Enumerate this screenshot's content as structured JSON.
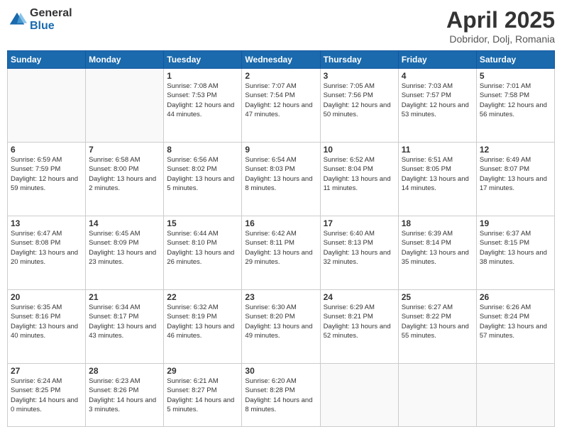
{
  "header": {
    "logo_general": "General",
    "logo_blue": "Blue",
    "month_title": "April 2025",
    "location": "Dobridor, Dolj, Romania"
  },
  "days_of_week": [
    "Sunday",
    "Monday",
    "Tuesday",
    "Wednesday",
    "Thursday",
    "Friday",
    "Saturday"
  ],
  "weeks": [
    [
      {
        "day": "",
        "info": ""
      },
      {
        "day": "",
        "info": ""
      },
      {
        "day": "1",
        "info": "Sunrise: 7:08 AM\nSunset: 7:53 PM\nDaylight: 12 hours and 44 minutes."
      },
      {
        "day": "2",
        "info": "Sunrise: 7:07 AM\nSunset: 7:54 PM\nDaylight: 12 hours and 47 minutes."
      },
      {
        "day": "3",
        "info": "Sunrise: 7:05 AM\nSunset: 7:56 PM\nDaylight: 12 hours and 50 minutes."
      },
      {
        "day": "4",
        "info": "Sunrise: 7:03 AM\nSunset: 7:57 PM\nDaylight: 12 hours and 53 minutes."
      },
      {
        "day": "5",
        "info": "Sunrise: 7:01 AM\nSunset: 7:58 PM\nDaylight: 12 hours and 56 minutes."
      }
    ],
    [
      {
        "day": "6",
        "info": "Sunrise: 6:59 AM\nSunset: 7:59 PM\nDaylight: 12 hours and 59 minutes."
      },
      {
        "day": "7",
        "info": "Sunrise: 6:58 AM\nSunset: 8:00 PM\nDaylight: 13 hours and 2 minutes."
      },
      {
        "day": "8",
        "info": "Sunrise: 6:56 AM\nSunset: 8:02 PM\nDaylight: 13 hours and 5 minutes."
      },
      {
        "day": "9",
        "info": "Sunrise: 6:54 AM\nSunset: 8:03 PM\nDaylight: 13 hours and 8 minutes."
      },
      {
        "day": "10",
        "info": "Sunrise: 6:52 AM\nSunset: 8:04 PM\nDaylight: 13 hours and 11 minutes."
      },
      {
        "day": "11",
        "info": "Sunrise: 6:51 AM\nSunset: 8:05 PM\nDaylight: 13 hours and 14 minutes."
      },
      {
        "day": "12",
        "info": "Sunrise: 6:49 AM\nSunset: 8:07 PM\nDaylight: 13 hours and 17 minutes."
      }
    ],
    [
      {
        "day": "13",
        "info": "Sunrise: 6:47 AM\nSunset: 8:08 PM\nDaylight: 13 hours and 20 minutes."
      },
      {
        "day": "14",
        "info": "Sunrise: 6:45 AM\nSunset: 8:09 PM\nDaylight: 13 hours and 23 minutes."
      },
      {
        "day": "15",
        "info": "Sunrise: 6:44 AM\nSunset: 8:10 PM\nDaylight: 13 hours and 26 minutes."
      },
      {
        "day": "16",
        "info": "Sunrise: 6:42 AM\nSunset: 8:11 PM\nDaylight: 13 hours and 29 minutes."
      },
      {
        "day": "17",
        "info": "Sunrise: 6:40 AM\nSunset: 8:13 PM\nDaylight: 13 hours and 32 minutes."
      },
      {
        "day": "18",
        "info": "Sunrise: 6:39 AM\nSunset: 8:14 PM\nDaylight: 13 hours and 35 minutes."
      },
      {
        "day": "19",
        "info": "Sunrise: 6:37 AM\nSunset: 8:15 PM\nDaylight: 13 hours and 38 minutes."
      }
    ],
    [
      {
        "day": "20",
        "info": "Sunrise: 6:35 AM\nSunset: 8:16 PM\nDaylight: 13 hours and 40 minutes."
      },
      {
        "day": "21",
        "info": "Sunrise: 6:34 AM\nSunset: 8:17 PM\nDaylight: 13 hours and 43 minutes."
      },
      {
        "day": "22",
        "info": "Sunrise: 6:32 AM\nSunset: 8:19 PM\nDaylight: 13 hours and 46 minutes."
      },
      {
        "day": "23",
        "info": "Sunrise: 6:30 AM\nSunset: 8:20 PM\nDaylight: 13 hours and 49 minutes."
      },
      {
        "day": "24",
        "info": "Sunrise: 6:29 AM\nSunset: 8:21 PM\nDaylight: 13 hours and 52 minutes."
      },
      {
        "day": "25",
        "info": "Sunrise: 6:27 AM\nSunset: 8:22 PM\nDaylight: 13 hours and 55 minutes."
      },
      {
        "day": "26",
        "info": "Sunrise: 6:26 AM\nSunset: 8:24 PM\nDaylight: 13 hours and 57 minutes."
      }
    ],
    [
      {
        "day": "27",
        "info": "Sunrise: 6:24 AM\nSunset: 8:25 PM\nDaylight: 14 hours and 0 minutes."
      },
      {
        "day": "28",
        "info": "Sunrise: 6:23 AM\nSunset: 8:26 PM\nDaylight: 14 hours and 3 minutes."
      },
      {
        "day": "29",
        "info": "Sunrise: 6:21 AM\nSunset: 8:27 PM\nDaylight: 14 hours and 5 minutes."
      },
      {
        "day": "30",
        "info": "Sunrise: 6:20 AM\nSunset: 8:28 PM\nDaylight: 14 hours and 8 minutes."
      },
      {
        "day": "",
        "info": ""
      },
      {
        "day": "",
        "info": ""
      },
      {
        "day": "",
        "info": ""
      }
    ]
  ]
}
